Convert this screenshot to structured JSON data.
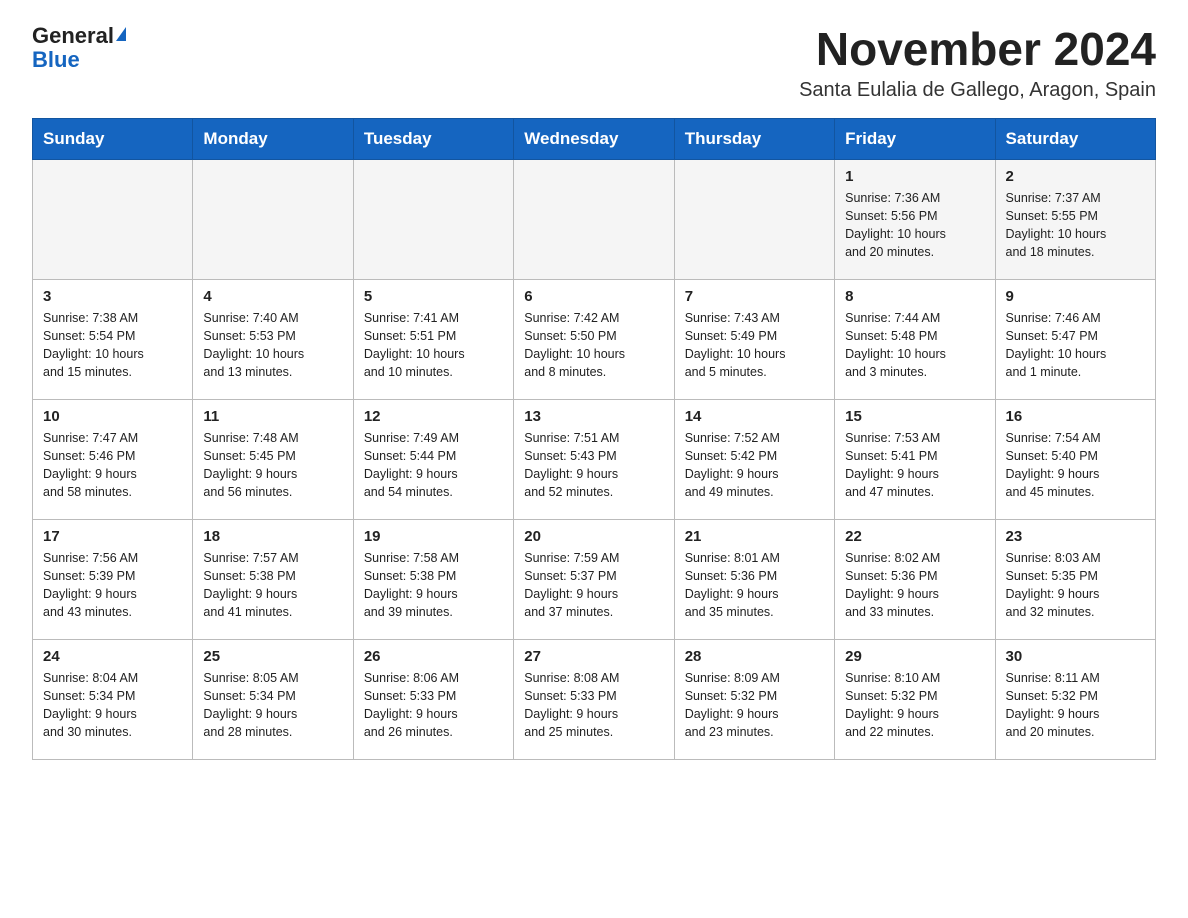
{
  "header": {
    "logo_general": "General",
    "logo_blue": "Blue",
    "month_title": "November 2024",
    "location": "Santa Eulalia de Gallego, Aragon, Spain"
  },
  "weekdays": [
    "Sunday",
    "Monday",
    "Tuesday",
    "Wednesday",
    "Thursday",
    "Friday",
    "Saturday"
  ],
  "weeks": [
    [
      {
        "day": "",
        "info": ""
      },
      {
        "day": "",
        "info": ""
      },
      {
        "day": "",
        "info": ""
      },
      {
        "day": "",
        "info": ""
      },
      {
        "day": "",
        "info": ""
      },
      {
        "day": "1",
        "info": "Sunrise: 7:36 AM\nSunset: 5:56 PM\nDaylight: 10 hours\nand 20 minutes."
      },
      {
        "day": "2",
        "info": "Sunrise: 7:37 AM\nSunset: 5:55 PM\nDaylight: 10 hours\nand 18 minutes."
      }
    ],
    [
      {
        "day": "3",
        "info": "Sunrise: 7:38 AM\nSunset: 5:54 PM\nDaylight: 10 hours\nand 15 minutes."
      },
      {
        "day": "4",
        "info": "Sunrise: 7:40 AM\nSunset: 5:53 PM\nDaylight: 10 hours\nand 13 minutes."
      },
      {
        "day": "5",
        "info": "Sunrise: 7:41 AM\nSunset: 5:51 PM\nDaylight: 10 hours\nand 10 minutes."
      },
      {
        "day": "6",
        "info": "Sunrise: 7:42 AM\nSunset: 5:50 PM\nDaylight: 10 hours\nand 8 minutes."
      },
      {
        "day": "7",
        "info": "Sunrise: 7:43 AM\nSunset: 5:49 PM\nDaylight: 10 hours\nand 5 minutes."
      },
      {
        "day": "8",
        "info": "Sunrise: 7:44 AM\nSunset: 5:48 PM\nDaylight: 10 hours\nand 3 minutes."
      },
      {
        "day": "9",
        "info": "Sunrise: 7:46 AM\nSunset: 5:47 PM\nDaylight: 10 hours\nand 1 minute."
      }
    ],
    [
      {
        "day": "10",
        "info": "Sunrise: 7:47 AM\nSunset: 5:46 PM\nDaylight: 9 hours\nand 58 minutes."
      },
      {
        "day": "11",
        "info": "Sunrise: 7:48 AM\nSunset: 5:45 PM\nDaylight: 9 hours\nand 56 minutes."
      },
      {
        "day": "12",
        "info": "Sunrise: 7:49 AM\nSunset: 5:44 PM\nDaylight: 9 hours\nand 54 minutes."
      },
      {
        "day": "13",
        "info": "Sunrise: 7:51 AM\nSunset: 5:43 PM\nDaylight: 9 hours\nand 52 minutes."
      },
      {
        "day": "14",
        "info": "Sunrise: 7:52 AM\nSunset: 5:42 PM\nDaylight: 9 hours\nand 49 minutes."
      },
      {
        "day": "15",
        "info": "Sunrise: 7:53 AM\nSunset: 5:41 PM\nDaylight: 9 hours\nand 47 minutes."
      },
      {
        "day": "16",
        "info": "Sunrise: 7:54 AM\nSunset: 5:40 PM\nDaylight: 9 hours\nand 45 minutes."
      }
    ],
    [
      {
        "day": "17",
        "info": "Sunrise: 7:56 AM\nSunset: 5:39 PM\nDaylight: 9 hours\nand 43 minutes."
      },
      {
        "day": "18",
        "info": "Sunrise: 7:57 AM\nSunset: 5:38 PM\nDaylight: 9 hours\nand 41 minutes."
      },
      {
        "day": "19",
        "info": "Sunrise: 7:58 AM\nSunset: 5:38 PM\nDaylight: 9 hours\nand 39 minutes."
      },
      {
        "day": "20",
        "info": "Sunrise: 7:59 AM\nSunset: 5:37 PM\nDaylight: 9 hours\nand 37 minutes."
      },
      {
        "day": "21",
        "info": "Sunrise: 8:01 AM\nSunset: 5:36 PM\nDaylight: 9 hours\nand 35 minutes."
      },
      {
        "day": "22",
        "info": "Sunrise: 8:02 AM\nSunset: 5:36 PM\nDaylight: 9 hours\nand 33 minutes."
      },
      {
        "day": "23",
        "info": "Sunrise: 8:03 AM\nSunset: 5:35 PM\nDaylight: 9 hours\nand 32 minutes."
      }
    ],
    [
      {
        "day": "24",
        "info": "Sunrise: 8:04 AM\nSunset: 5:34 PM\nDaylight: 9 hours\nand 30 minutes."
      },
      {
        "day": "25",
        "info": "Sunrise: 8:05 AM\nSunset: 5:34 PM\nDaylight: 9 hours\nand 28 minutes."
      },
      {
        "day": "26",
        "info": "Sunrise: 8:06 AM\nSunset: 5:33 PM\nDaylight: 9 hours\nand 26 minutes."
      },
      {
        "day": "27",
        "info": "Sunrise: 8:08 AM\nSunset: 5:33 PM\nDaylight: 9 hours\nand 25 minutes."
      },
      {
        "day": "28",
        "info": "Sunrise: 8:09 AM\nSunset: 5:32 PM\nDaylight: 9 hours\nand 23 minutes."
      },
      {
        "day": "29",
        "info": "Sunrise: 8:10 AM\nSunset: 5:32 PM\nDaylight: 9 hours\nand 22 minutes."
      },
      {
        "day": "30",
        "info": "Sunrise: 8:11 AM\nSunset: 5:32 PM\nDaylight: 9 hours\nand 20 minutes."
      }
    ]
  ]
}
